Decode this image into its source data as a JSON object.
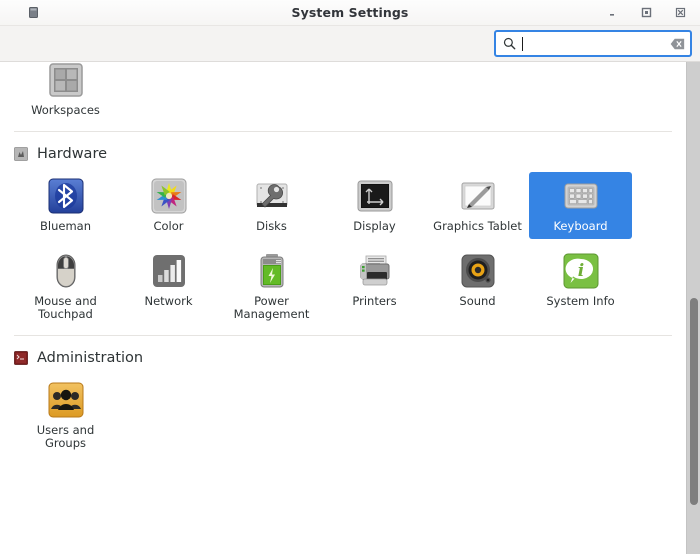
{
  "window": {
    "title": "System Settings",
    "app_icon": "window-icon",
    "controls": [
      {
        "name": "minimize-button",
        "glyph": "minimize-icon"
      },
      {
        "name": "maximize-button",
        "glyph": "maximize-icon"
      },
      {
        "name": "close-button",
        "glyph": "close-icon"
      }
    ]
  },
  "search": {
    "icon": "search-icon",
    "value": "",
    "placeholder": "",
    "clear_icon": "clear-icon",
    "focused": true
  },
  "scrollbar": {
    "orientation": "vertical",
    "thumb_top_pct": 48,
    "thumb_height_pct": 42
  },
  "sections": [
    {
      "id": "top-partial",
      "header": null,
      "show_separator": false,
      "items": [
        {
          "label": "Workspaces",
          "icon": "workspaces-icon",
          "selected": false
        }
      ]
    },
    {
      "id": "hardware",
      "header": {
        "label": "Hardware",
        "icon": "hardware-icon"
      },
      "show_separator": true,
      "items": [
        {
          "label": "Blueman",
          "icon": "bluetooth-icon",
          "selected": false
        },
        {
          "label": "Color",
          "icon": "color-icon",
          "selected": false
        },
        {
          "label": "Disks",
          "icon": "disks-icon",
          "selected": false
        },
        {
          "label": "Display",
          "icon": "display-icon",
          "selected": false
        },
        {
          "label": "Graphics Tablet",
          "icon": "graphics-tablet-icon",
          "selected": false
        },
        {
          "label": "Keyboard",
          "icon": "keyboard-icon",
          "selected": true
        },
        {
          "label": "Mouse and Touchpad",
          "icon": "mouse-icon",
          "selected": false
        },
        {
          "label": "Network",
          "icon": "network-icon",
          "selected": false
        },
        {
          "label": "Power Management",
          "icon": "battery-icon",
          "selected": false
        },
        {
          "label": "Printers",
          "icon": "printer-icon",
          "selected": false
        },
        {
          "label": "Sound",
          "icon": "sound-icon",
          "selected": false
        },
        {
          "label": "System Info",
          "icon": "info-icon",
          "selected": false
        }
      ]
    },
    {
      "id": "administration",
      "header": {
        "label": "Administration",
        "icon": "administration-icon"
      },
      "show_separator": true,
      "items": [
        {
          "label": "Users and Groups",
          "icon": "users-groups-icon",
          "selected": false
        }
      ]
    }
  ],
  "colors": {
    "selection": "#3584e4",
    "titlebar_text": "#32353a",
    "label_text": "#2e3436",
    "separator": "#e6e4e1",
    "toolbar_bg": "#f4f3f2"
  }
}
